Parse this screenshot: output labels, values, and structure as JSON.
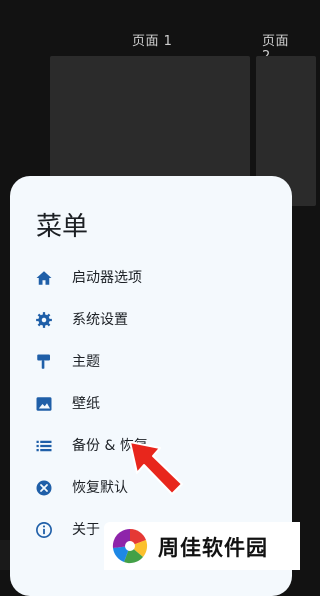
{
  "pages": {
    "page1_label": "页面 1",
    "page2_label": "页面 2"
  },
  "menu": {
    "title": "菜单",
    "items": [
      {
        "label": "启动器选项",
        "icon": "home-icon"
      },
      {
        "label": "系统设置",
        "icon": "gear-icon"
      },
      {
        "label": "主题",
        "icon": "paint-roller-icon"
      },
      {
        "label": "壁纸",
        "icon": "image-icon"
      },
      {
        "label": "备份 & 恢复",
        "icon": "list-icon"
      },
      {
        "label": "恢复默认",
        "icon": "close-circle-icon"
      },
      {
        "label": "关于",
        "icon": "info-icon"
      }
    ]
  },
  "watermark": {
    "text": "周佳软件园"
  },
  "colors": {
    "accent": "#1f5fa8",
    "arrow": "#e8261c",
    "sheet_bg": "#f4f9fd",
    "background": "#121212"
  }
}
